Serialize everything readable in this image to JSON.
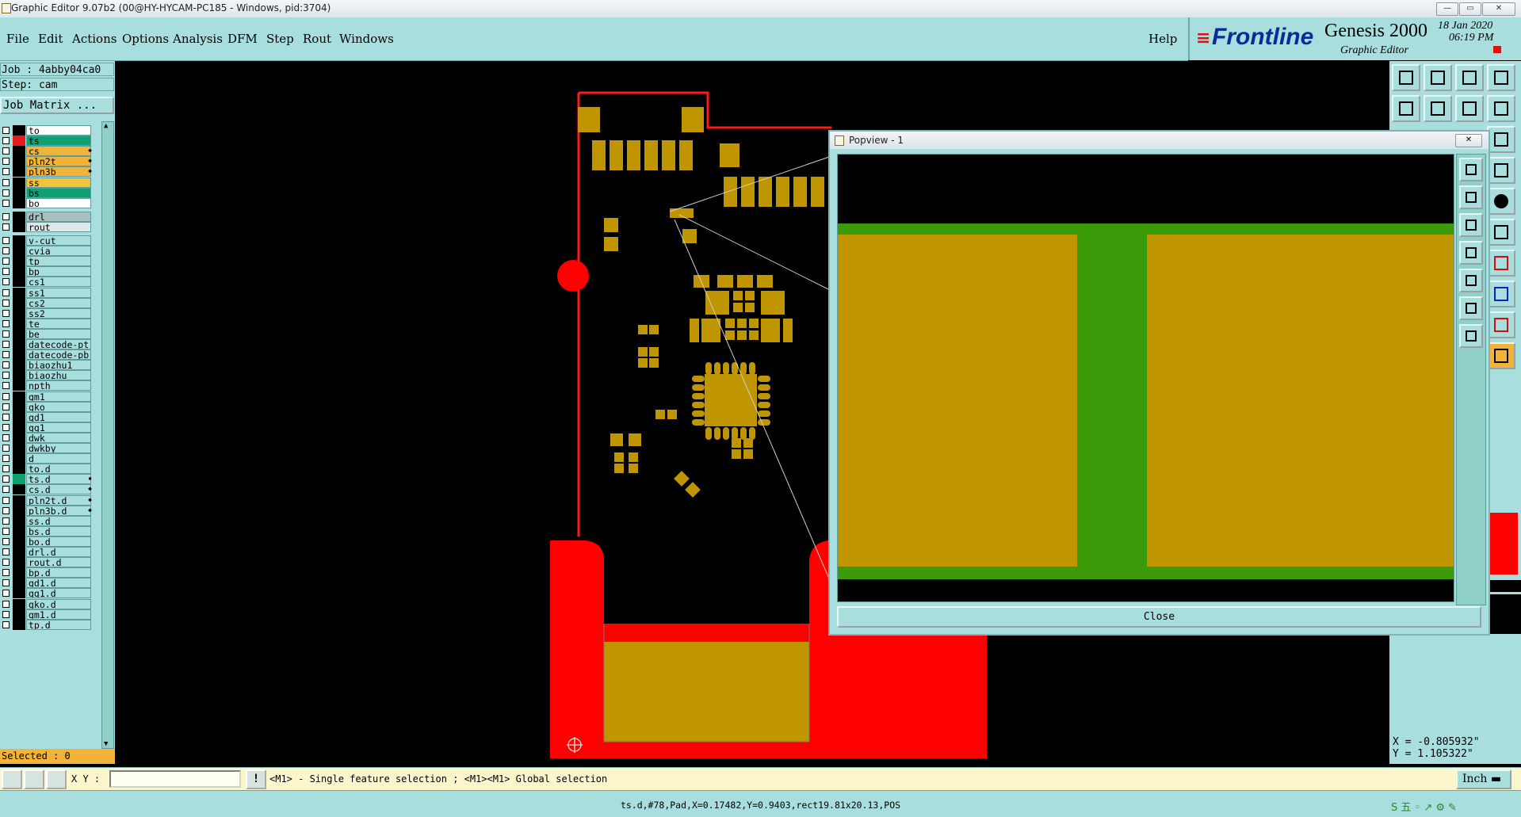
{
  "window": {
    "title": "Graphic Editor 9.07b2 (00@HY-HYCAM-PC185 - Windows, pid:3704)"
  },
  "menu": {
    "items": [
      "File",
      "Edit",
      "Actions",
      "Options",
      "Analysis",
      "DFM",
      "Step",
      "Rout",
      "Windows"
    ],
    "help": "Help"
  },
  "brand": {
    "logo": "Frontline",
    "product": "Genesis 2000",
    "subtitle": "Graphic Editor",
    "date": "18 Jan 2020",
    "time": "06:19 PM"
  },
  "job": {
    "job_label": "Job : 4abby04ca0",
    "step_label": "Step: cam",
    "matrix_button": "Job Matrix ..."
  },
  "layers": [
    {
      "name": "to",
      "color": "#ffffff",
      "swatch": "#000000",
      "mark": ""
    },
    {
      "name": "ts",
      "color": "#0f9f72",
      "swatch": "#e61b1b",
      "mark": ""
    },
    {
      "name": "cs",
      "color": "#f2b33a",
      "swatch": "#000000",
      "mark": "◆"
    },
    {
      "name": "pln2t",
      "color": "#f2b33a",
      "swatch": "#000000",
      "mark": "◆"
    },
    {
      "name": "pln3b",
      "color": "#f2b33a",
      "swatch": "#000000",
      "mark": "◆"
    },
    {
      "name": "ss",
      "color": "#f2c33a",
      "swatch": "#000000",
      "mark": ""
    },
    {
      "name": "bs",
      "color": "#0f9f72",
      "swatch": "#000000",
      "mark": ""
    },
    {
      "name": "bo",
      "color": "#ffffff",
      "swatch": "#000000",
      "mark": ""
    },
    {
      "name": "drl",
      "color": "#a9bfbe",
      "swatch": "#000000",
      "mark": ""
    },
    {
      "name": "rout",
      "color": "#dfe6e6",
      "swatch": "#000000",
      "mark": ""
    },
    {
      "name": "v-cut",
      "color": "#a8dedd",
      "swatch": "#000000",
      "mark": ""
    },
    {
      "name": "cvia",
      "color": "#a8dedd",
      "swatch": "#000000",
      "mark": ""
    },
    {
      "name": "tp",
      "color": "#a8dedd",
      "swatch": "#000000",
      "mark": ""
    },
    {
      "name": "bp",
      "color": "#a8dedd",
      "swatch": "#000000",
      "mark": ""
    },
    {
      "name": "cs1",
      "color": "#a8dedd",
      "swatch": "#000000",
      "mark": ""
    },
    {
      "name": "ss1",
      "color": "#a8dedd",
      "swatch": "#000000",
      "mark": ""
    },
    {
      "name": "cs2",
      "color": "#a8dedd",
      "swatch": "#000000",
      "mark": ""
    },
    {
      "name": "ss2",
      "color": "#a8dedd",
      "swatch": "#000000",
      "mark": ""
    },
    {
      "name": "te",
      "color": "#a8dedd",
      "swatch": "#000000",
      "mark": ""
    },
    {
      "name": "be",
      "color": "#a8dedd",
      "swatch": "#000000",
      "mark": ""
    },
    {
      "name": "datecode-pt",
      "color": "#a8dedd",
      "swatch": "#000000",
      "mark": ""
    },
    {
      "name": "datecode-pb",
      "color": "#a8dedd",
      "swatch": "#000000",
      "mark": ""
    },
    {
      "name": "biaozhu1",
      "color": "#a8dedd",
      "swatch": "#000000",
      "mark": ""
    },
    {
      "name": "biaozhu",
      "color": "#a8dedd",
      "swatch": "#000000",
      "mark": ""
    },
    {
      "name": "npth",
      "color": "#a8dedd",
      "swatch": "#000000",
      "mark": ""
    },
    {
      "name": "gm1",
      "color": "#a8dedd",
      "swatch": "#000000",
      "mark": ""
    },
    {
      "name": "gko",
      "color": "#a8dedd",
      "swatch": "#000000",
      "mark": ""
    },
    {
      "name": "gd1",
      "color": "#a8dedd",
      "swatch": "#000000",
      "mark": ""
    },
    {
      "name": "gg1",
      "color": "#a8dedd",
      "swatch": "#000000",
      "mark": ""
    },
    {
      "name": "dwk",
      "color": "#a8dedd",
      "swatch": "#000000",
      "mark": ""
    },
    {
      "name": "dwkby",
      "color": "#a8dedd",
      "swatch": "#000000",
      "mark": ""
    },
    {
      "name": "d",
      "color": "#a8dedd",
      "swatch": "#000000",
      "mark": ""
    },
    {
      "name": "to.d",
      "color": "#a8dedd",
      "swatch": "#000000",
      "mark": ""
    },
    {
      "name": "ts.d",
      "color": "#a8dedd",
      "swatch": "#0f9f72",
      "mark": "▪"
    },
    {
      "name": "cs.d",
      "color": "#a8dedd",
      "swatch": "#000000",
      "mark": "◆"
    },
    {
      "name": "pln2t.d",
      "color": "#a8dedd",
      "swatch": "#000000",
      "mark": "◆"
    },
    {
      "name": "pln3b.d",
      "color": "#a8dedd",
      "swatch": "#000000",
      "mark": "◆"
    },
    {
      "name": "ss.d",
      "color": "#a8dedd",
      "swatch": "#000000",
      "mark": ""
    },
    {
      "name": "bs.d",
      "color": "#a8dedd",
      "swatch": "#000000",
      "mark": ""
    },
    {
      "name": "bo.d",
      "color": "#a8dedd",
      "swatch": "#000000",
      "mark": ""
    },
    {
      "name": "drl.d",
      "color": "#a8dedd",
      "swatch": "#000000",
      "mark": ""
    },
    {
      "name": "rout.d",
      "color": "#a8dedd",
      "swatch": "#000000",
      "mark": ""
    },
    {
      "name": "bp.d",
      "color": "#a8dedd",
      "swatch": "#000000",
      "mark": ""
    },
    {
      "name": "gd1.d",
      "color": "#a8dedd",
      "swatch": "#000000",
      "mark": ""
    },
    {
      "name": "gg1.d",
      "color": "#a8dedd",
      "swatch": "#000000",
      "mark": ""
    },
    {
      "name": "gko.d",
      "color": "#a8dedd",
      "swatch": "#000000",
      "mark": ""
    },
    {
      "name": "gm1.d",
      "color": "#a8dedd",
      "swatch": "#000000",
      "mark": ""
    },
    {
      "name": "tp.d",
      "color": "#a8dedd",
      "swatch": "#000000",
      "mark": ""
    }
  ],
  "selected": "Selected : 0",
  "coords": {
    "x": "X = -0.805932\"",
    "y": "Y = 1.105322\""
  },
  "cmdbar": {
    "xy_label": "X Y :",
    "xy_value": "",
    "prompt": "<M1> - Single feature selection ; <M1><M1> Global selection",
    "units": "Inch"
  },
  "status": "ts.d,#78,Pad,X=0.17482,Y=0.9403,rect19.81x20.13,POS",
  "popview": {
    "title": "Popview - 1",
    "close_label": "Close"
  },
  "colors": {
    "panel": "#a8dedd",
    "pad": "#bf9500",
    "copper_red": "#ff0000",
    "pv_green": "#3a9a07"
  }
}
